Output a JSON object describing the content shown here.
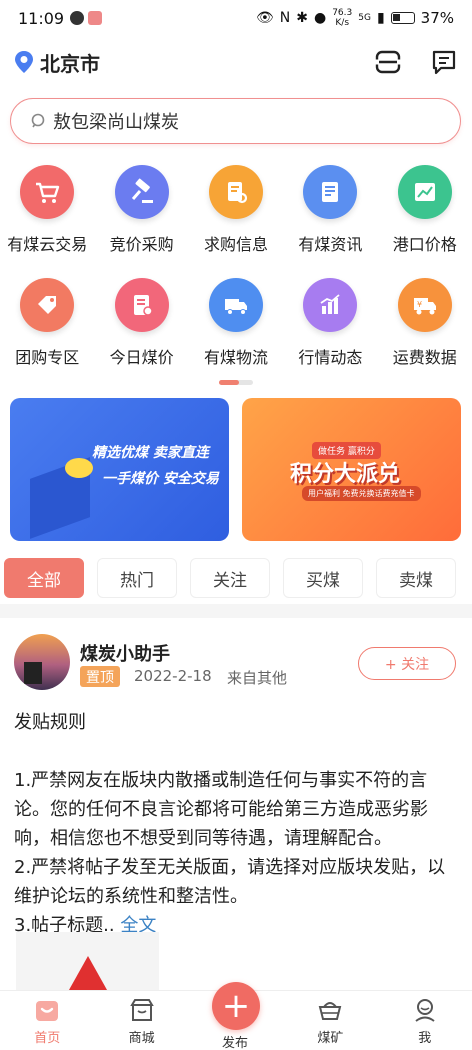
{
  "status_bar": {
    "time": "11:09",
    "speed_value": "76.3",
    "speed_unit": "K/s",
    "signal": "5G",
    "battery": "37%"
  },
  "header": {
    "city": "北京市"
  },
  "search": {
    "text": "敖包梁尚山煤炭"
  },
  "grid": [
    {
      "label": "有煤云交易",
      "color": "#f26a6a",
      "icon": "cart-icon"
    },
    {
      "label": "竞价采购",
      "color": "#6b7cf0",
      "icon": "gavel-icon"
    },
    {
      "label": "求购信息",
      "color": "#f7a436",
      "icon": "document-search-icon"
    },
    {
      "label": "有煤资讯",
      "color": "#5b8ff0",
      "icon": "news-icon"
    },
    {
      "label": "港口价格",
      "color": "#3cc48f",
      "icon": "chart-frame-icon"
    },
    {
      "label": "团购专区",
      "color": "#f27a62",
      "icon": "tag-icon"
    },
    {
      "label": "今日煤价",
      "color": "#f2677a",
      "icon": "price-list-icon"
    },
    {
      "label": "有煤物流",
      "color": "#4f8ef0",
      "icon": "truck-icon"
    },
    {
      "label": "行情动态",
      "color": "#a77cf0",
      "icon": "bar-chart-icon"
    },
    {
      "label": "运费数据",
      "color": "#f7923c",
      "icon": "freight-truck-icon"
    }
  ],
  "banners": {
    "b1_line1": "精选优煤 卖家直连",
    "b1_line2": "一手煤价 安全交易",
    "b2_tag": "做任务 赢积分",
    "b2_title": "积分大派兑",
    "b2_sub": "用户福利 免费兑换话费充值卡"
  },
  "tabs": [
    "全部",
    "热门",
    "关注",
    "买煤",
    "卖煤"
  ],
  "post": {
    "author": "煤炭小助手",
    "pin": "置顶",
    "date": "2022-2-18",
    "source": "来自其他",
    "follow": "+ 关注",
    "title": "发贴规则",
    "line1": "1.严禁网友在版块内散播或制造任何与事实不符的言论。您的任何不良言论都将可能给第三方造成恶劣影响，相信您也不想受到同等待遇，请理解配合。",
    "line2": "2.严禁将帖子发至无关版面，请选择对应版块发贴，以维护论坛的系统性和整洁性。",
    "line3": "3.帖子标题..",
    "more": "全文"
  },
  "nav": [
    {
      "label": "首页",
      "icon": "home-icon"
    },
    {
      "label": "商城",
      "icon": "shop-icon"
    },
    {
      "label": "发布",
      "icon": "plus-icon"
    },
    {
      "label": "煤矿",
      "icon": "mine-cart-icon"
    },
    {
      "label": "我",
      "icon": "user-icon"
    }
  ]
}
